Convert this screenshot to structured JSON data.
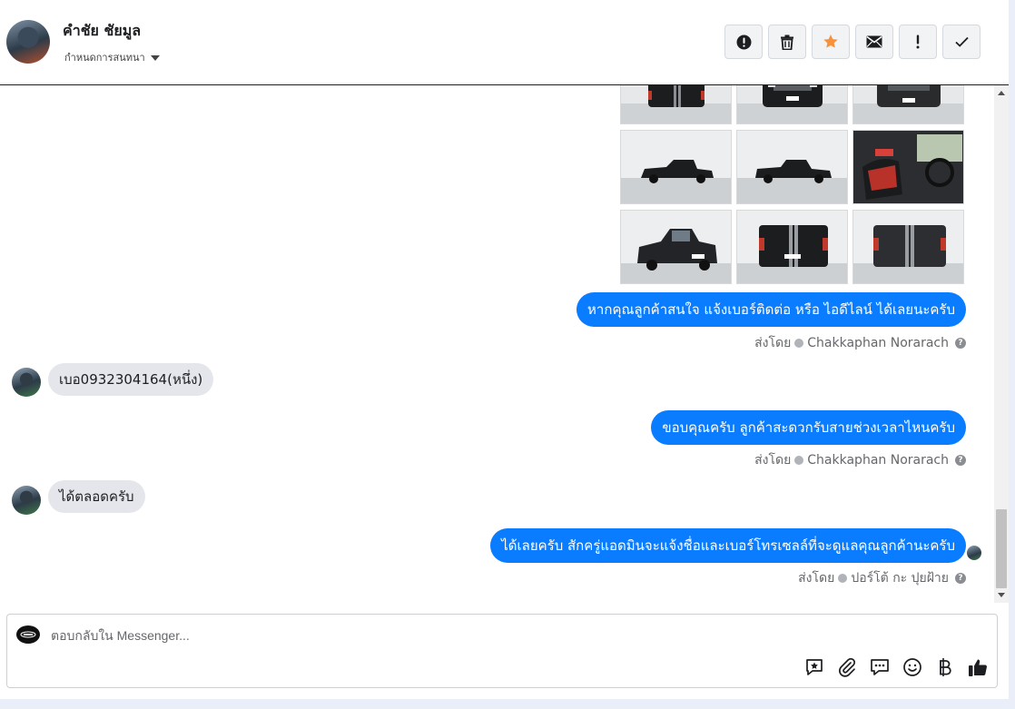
{
  "header": {
    "contact_name": "คำชัย ชัยมูล",
    "assign_label": "กำหนดการสนทนา",
    "actions": [
      {
        "name": "mark-spam-button",
        "icon": "alert-circle-icon"
      },
      {
        "name": "delete-button",
        "icon": "trash-icon"
      },
      {
        "name": "star-button",
        "icon": "star-icon"
      },
      {
        "name": "mark-unread-button",
        "icon": "envelope-icon"
      },
      {
        "name": "follow-up-button",
        "icon": "exclamation-icon"
      },
      {
        "name": "mark-done-button",
        "icon": "checkmark-icon"
      }
    ]
  },
  "thread": {
    "messages": [
      {
        "direction": "out",
        "text": "หากคุณลูกค้าสนใจ แจ้งเบอร์ติดต่อ หรือ ไอดีไลน์ ได้เลยนะครับ",
        "sent_by_label": "ส่งโดย",
        "sender": "Chakkaphan Norarach"
      },
      {
        "direction": "in",
        "text": "เบอ0932304164(หนึ่ง)"
      },
      {
        "direction": "out",
        "text": "ขอบคุณครับ ลูกค้าสะดวกรับสายช่วงเวลาไหนครับ",
        "sent_by_label": "ส่งโดย",
        "sender": "Chakkaphan Norarach"
      },
      {
        "direction": "in",
        "text": "ได้ตลอดครับ"
      },
      {
        "direction": "out",
        "text": "ได้เลยครับ สักครู่แอดมินจะแจ้งชื่อและเบอร์โทรเซลล์ที่จะดูแลคุณลูกค้านะครับ",
        "sent_by_label": "ส่งโดย",
        "sender": "ปอร์โต้ กะ ปุยฝ้าย"
      }
    ]
  },
  "composer": {
    "placeholder": "ตอบกลับใน Messenger...",
    "tools": [
      "saved-reply-icon",
      "attachment-icon",
      "chat-bubbles-icon",
      "emoji-icon",
      "baht-icon",
      "thumbs-up-icon"
    ]
  },
  "colors": {
    "accent": "#0a7cff",
    "star": "#f7923a",
    "incoming_bubble": "#e4e6eb"
  }
}
